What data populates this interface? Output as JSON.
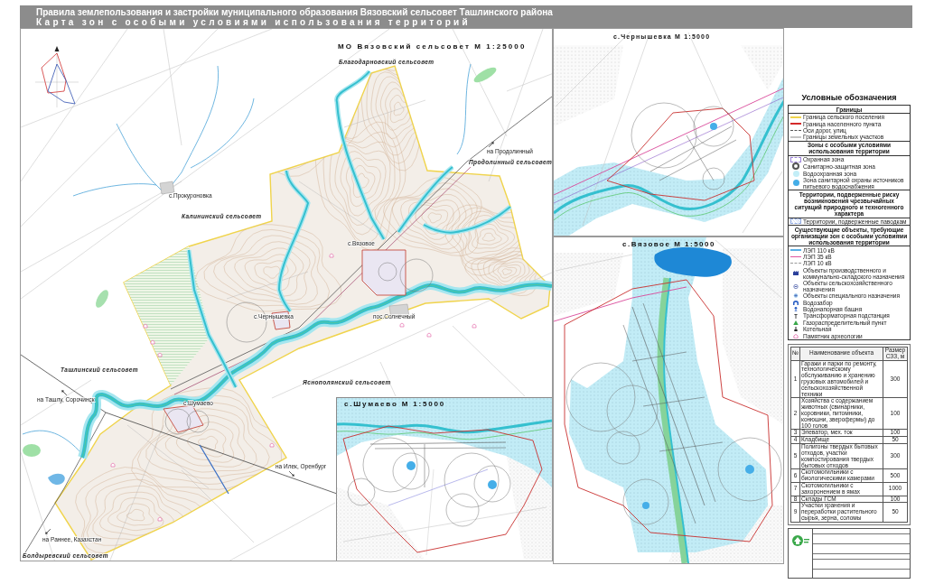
{
  "header": {
    "title": "Правила землепользования и застройки муниципального образования Вязовский сельсовет Ташлинского района",
    "subtitle": "Карта зон с особыми условиями использования территорий"
  },
  "main_map": {
    "title": "МО Вязовский сельсовет М 1:25000",
    "labels": [
      {
        "text": "Благодарновский сельсовет",
        "kind": "district"
      },
      {
        "text": "на Продолинный",
        "kind": "direction"
      },
      {
        "text": "Продолинный сельсовет",
        "kind": "district"
      },
      {
        "text": "с.Прокуроновка",
        "kind": "settlement"
      },
      {
        "text": "Калининский сельсовет",
        "kind": "district"
      },
      {
        "text": "с.Вязовое",
        "kind": "settlement"
      },
      {
        "text": "с.Чернышевка",
        "kind": "settlement"
      },
      {
        "text": "пос.Солнечный",
        "kind": "settlement"
      },
      {
        "text": "Ташлинский сельсовет",
        "kind": "district"
      },
      {
        "text": "Яснополянский сельсовет",
        "kind": "district"
      },
      {
        "text": "на Ташлу, Сорочинск",
        "kind": "direction"
      },
      {
        "text": "с.Шумаево",
        "kind": "settlement"
      },
      {
        "text": "на Илек, Оренбург",
        "kind": "direction"
      },
      {
        "text": "на Раннее, Казахстан",
        "kind": "direction"
      },
      {
        "text": "Болдыревский сельсовет",
        "kind": "district"
      }
    ],
    "inset": {
      "title": "с.Шумаево М 1:5000"
    }
  },
  "village_maps": [
    {
      "title": "с.Чернышевка М 1:5000"
    },
    {
      "title": "с.Вязовое М 1:5000"
    }
  ],
  "legend": {
    "title": "Условные обозначения",
    "sections": [
      {
        "title": "Границы",
        "items": [
          {
            "kind": "line",
            "color": "#f0d44c",
            "label": "Граница сельского поселения"
          },
          {
            "kind": "line",
            "color": "#d42a2a",
            "label": "Граница населенного пункта"
          },
          {
            "kind": "dashed",
            "color": "#555555",
            "label": "Оси дорог, улиц"
          },
          {
            "kind": "line",
            "color": "#c4c4c4",
            "label": "Границы земельных участков"
          }
        ]
      },
      {
        "title": "Зоны с особыми условиями использования территории",
        "items": [
          {
            "kind": "dash-rect",
            "color": "#9a7fd8",
            "label": "Охранная зона"
          },
          {
            "kind": "circle",
            "color": "#555555",
            "label": "Санитарно-защитная зона"
          },
          {
            "kind": "disc",
            "color": "#c3eef7",
            "label": "Водоохранная зона"
          },
          {
            "kind": "disc",
            "color": "#45aee8",
            "label": "Зона санитарной охраны источников питьевого водоснабжения"
          },
          {
            "kind": "note",
            "label": "Территории, подверженные риску возникновения чрезвычайных ситуаций природного и техногенного характера"
          },
          {
            "kind": "hatch-rect",
            "color": "#8fa8e0",
            "label": "Территории, подверженные паводкам"
          }
        ]
      },
      {
        "title": "Существующие объекты, требующие организации зон с особыми условиями использования территории",
        "items": [
          {
            "kind": "line",
            "color": "#5ab0e6",
            "label": "ЛЭП 110 кВ"
          },
          {
            "kind": "line",
            "color": "#e0559f",
            "label": "ЛЭП 35 кВ"
          },
          {
            "kind": "dashed",
            "color": "#9a9a9a",
            "label": "ЛЭП 10 кВ"
          },
          {
            "kind": "factory",
            "label": "Объекты производственного и коммунально-складского назначения"
          },
          {
            "kind": "farm",
            "label": "Объекты сельскохозяйственного назначения"
          },
          {
            "kind": "special",
            "label": "Объекты специального назначения"
          },
          {
            "kind": "intake",
            "label": "Водозабор"
          },
          {
            "kind": "tower",
            "label": "Водонапорная башня"
          },
          {
            "kind": "substation",
            "label": "Трансформаторная подстанция"
          },
          {
            "kind": "gas",
            "label": "Газораспределительный пункт"
          },
          {
            "kind": "boiler",
            "label": "Котельная"
          },
          {
            "kind": "monument",
            "label": "Памятник археологии"
          }
        ]
      }
    ]
  },
  "objects_table": {
    "columns": [
      "№",
      "Наименование объекта",
      "Размер СЗЗ, м"
    ],
    "rows": [
      {
        "number": "1",
        "name": "Гаражи и парки по ремонту, технологическому обслуживанию и хранению грузовых автомобилей и сельскохозяйственной техники",
        "size": "300"
      },
      {
        "number": "2",
        "name": "Хозяйства с содержанием животных (свинарники, коровники, питомники, конюшни, зверофермы) до 100 голов",
        "size": "100"
      },
      {
        "number": "3",
        "name": "Элеватор, мех. ток",
        "size": "100"
      },
      {
        "number": "4",
        "name": "Кладбище",
        "size": "50"
      },
      {
        "number": "5",
        "name": "Полигоны твердых бытовых отходов, участки компостирования твердых бытовых отходов",
        "size": "300"
      },
      {
        "number": "6",
        "name": "Скотомогильники с биологическими камерами",
        "size": "500"
      },
      {
        "number": "7",
        "name": "Скотомогильники с захоронением в ямах",
        "size": "1000"
      },
      {
        "number": "8",
        "name": "Склады ГСМ",
        "size": "100"
      },
      {
        "number": "9",
        "name": "Участки хранения и переработки растительного сырья, зерна, соломы",
        "size": "50"
      }
    ]
  }
}
